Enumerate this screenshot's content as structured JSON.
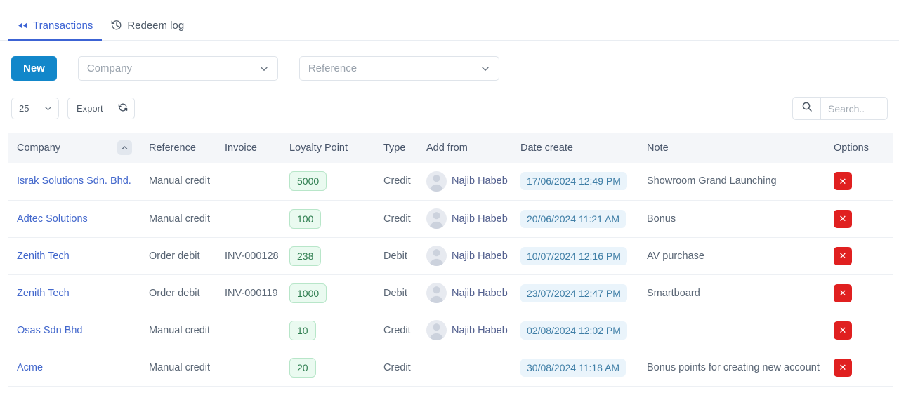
{
  "tabs": [
    {
      "label": "Transactions",
      "icon": "rewind-icon",
      "active": true
    },
    {
      "label": "Redeem log",
      "icon": "history-icon",
      "active": false
    }
  ],
  "toolbar": {
    "new_label": "New",
    "company_filter_placeholder": "Company",
    "reference_filter_placeholder": "Reference"
  },
  "toolbar2": {
    "page_length": "25",
    "export_label": "Export",
    "refresh_icon": "refresh-icon",
    "search_icon": "search-icon",
    "search_value": "",
    "search_placeholder": "Search.."
  },
  "table": {
    "sort": {
      "column": "Company",
      "direction": "asc",
      "icon": "chevron-up-icon"
    },
    "headers": [
      "Company",
      "Reference",
      "Invoice",
      "Loyalty Point",
      "Type",
      "Add from",
      "Date create",
      "Note",
      "Options"
    ],
    "rows": [
      {
        "company": "Israk Solutions Sdn. Bhd.",
        "reference": "Manual credit",
        "invoice": "",
        "points": "5000",
        "type": "Credit",
        "add_from": "Najib Habeb",
        "date_create": "17/06/2024 12:49 PM",
        "note": "Showroom Grand Launching",
        "delete_label": "✕"
      },
      {
        "company": "Adtec Solutions",
        "reference": "Manual credit",
        "invoice": "",
        "points": "100",
        "type": "Credit",
        "add_from": "Najib Habeb",
        "date_create": "20/06/2024 11:21 AM",
        "note": "Bonus",
        "delete_label": "✕"
      },
      {
        "company": "Zenith Tech",
        "reference": "Order debit",
        "invoice": "INV-000128",
        "points": "238",
        "type": "Debit",
        "add_from": "Najib Habeb",
        "date_create": "10/07/2024 12:16 PM",
        "note": "AV purchase",
        "delete_label": "✕"
      },
      {
        "company": "Zenith Tech",
        "reference": "Order debit",
        "invoice": "INV-000119",
        "points": "1000",
        "type": "Debit",
        "add_from": "Najib Habeb",
        "date_create": "23/07/2024 12:47 PM",
        "note": "Smartboard",
        "delete_label": "✕"
      },
      {
        "company": "Osas Sdn Bhd",
        "reference": "Manual credit",
        "invoice": "",
        "points": "10",
        "type": "Credit",
        "add_from": "Najib Habeb",
        "date_create": "02/08/2024 12:02 PM",
        "note": "",
        "delete_label": "✕"
      },
      {
        "company": "Acme",
        "reference": "Manual credit",
        "invoice": "",
        "points": "20",
        "type": "Credit",
        "add_from": "",
        "date_create": "30/08/2024 11:18 AM",
        "note": "Bonus points for creating new account",
        "delete_label": "✕"
      }
    ]
  },
  "colors": {
    "accent_blue": "#3c63d4",
    "new_button": "#1287ca",
    "link": "#4267cc",
    "points_badge_bg": "#eafaf0",
    "points_badge_text": "#2e7d4f",
    "date_badge_bg": "#eaf4fb",
    "date_badge_text": "#3f7ea6",
    "delete_button": "#e02020",
    "header_bg": "#f4f6f9"
  }
}
